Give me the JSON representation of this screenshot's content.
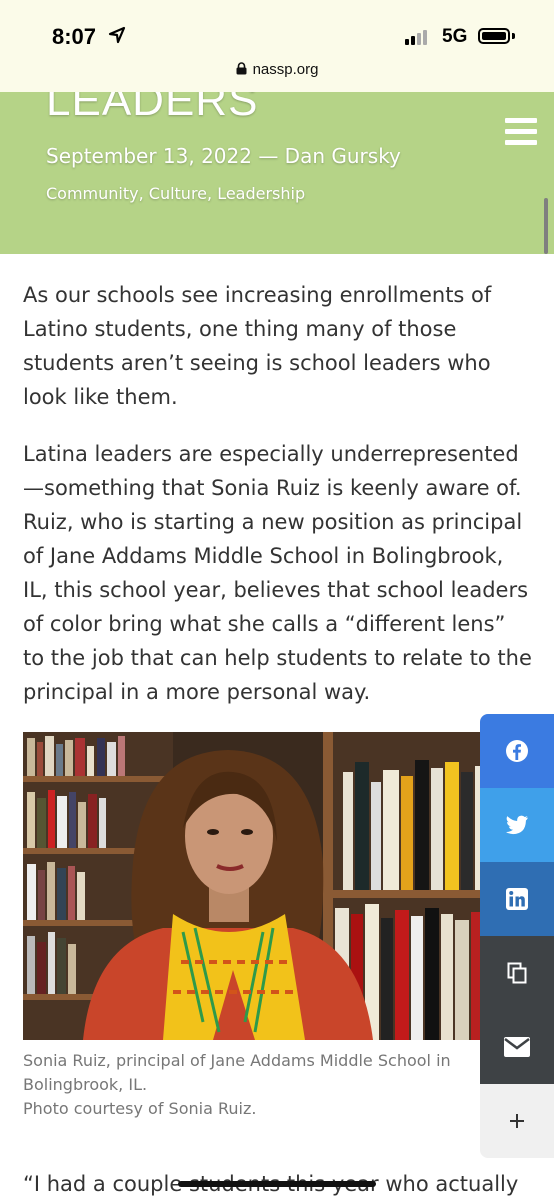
{
  "status_bar": {
    "time": "8:07",
    "network": "5G",
    "url": "nassp.org"
  },
  "article": {
    "title_fragment": "LEADERS",
    "meta": "September 13, 2022 — Dan Gursky",
    "categories": "Community, Culture, Leadership",
    "paragraph_1": "As our schools see increasing enrollments of Latino students, one thing many of those students aren’t seeing is school leaders who look like them.",
    "paragraph_2": "Latina leaders are especially underrepresented—something that Sonia Ruiz is keenly aware of. Ruiz, who is starting a new position as principal of Jane Addams Middle School in Bolingbrook, IL, this school year, believes that school leaders of color bring what she calls a “different lens” to the job that can help students to relate to the principal in a more personal way.",
    "caption_line_1": "Sonia Ruiz, principal of Jane Addams Middle School in Bolingbrook, IL.",
    "caption_line_2": "Photo courtesy of Sonia Ruiz.",
    "quote_start": "“I had a couple students this year who actually"
  },
  "share_bar": {
    "items": [
      {
        "icon": "facebook-icon"
      },
      {
        "icon": "twitter-icon"
      },
      {
        "icon": "linkedin-icon"
      },
      {
        "icon": "copy-icon"
      },
      {
        "icon": "email-icon"
      },
      {
        "icon": "plus-icon"
      }
    ]
  },
  "colors": {
    "header_green": "#b5d387",
    "status_bar_bg": "#fbfbe9",
    "facebook": "#3b7be1",
    "twitter": "#3fa0ea",
    "linkedin": "#2f6eb3",
    "dark_share": "#3e4245"
  }
}
